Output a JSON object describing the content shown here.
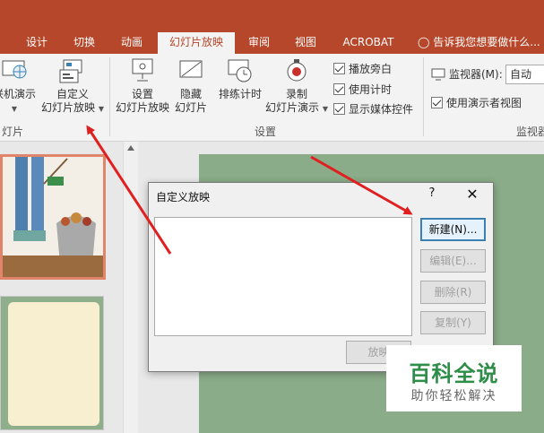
{
  "ribbon_tabs": [
    {
      "label": "设计"
    },
    {
      "label": "切换"
    },
    {
      "label": "动画"
    },
    {
      "label": "幻灯片放映",
      "active": true
    },
    {
      "label": "审阅"
    },
    {
      "label": "视图"
    },
    {
      "label": "ACROBAT"
    }
  ],
  "tell_me": "告诉我您想要做什么...",
  "ribbon": {
    "group_start": {
      "online_label": "联机演示",
      "custom_line1": "自定义",
      "custom_line2": "幻灯片放映",
      "group_label": "灯片"
    },
    "group_setup": {
      "setup_line1": "设置",
      "setup_line2": "幻灯片放映",
      "hide_line1": "隐藏",
      "hide_line2": "幻灯片",
      "rehearse_label": "排练计时",
      "record_line1": "录制",
      "record_line2": "幻灯片演示",
      "chk_narration": "播放旁白",
      "chk_timing": "使用计时",
      "chk_media": "显示媒体控件",
      "group_label": "设置"
    },
    "group_monitor": {
      "monitor_label": "监视器(M):",
      "monitor_value": "自动",
      "presenter_view": "使用演示者视图",
      "group_label": "监视器"
    }
  },
  "dialog": {
    "title": "自定义放映",
    "help": "?",
    "close": "✕",
    "buttons": {
      "new": "新建(N)...",
      "edit": "编辑(E)...",
      "delete": "删除(R)",
      "copy": "复制(Y)",
      "show": "放映"
    }
  },
  "watermark": {
    "title": "百科全说",
    "subtitle": "助你轻松解决"
  },
  "colors": {
    "accent": "#b7472a",
    "arrow": "#e02020",
    "watermark_green": "#2f8d4a"
  }
}
